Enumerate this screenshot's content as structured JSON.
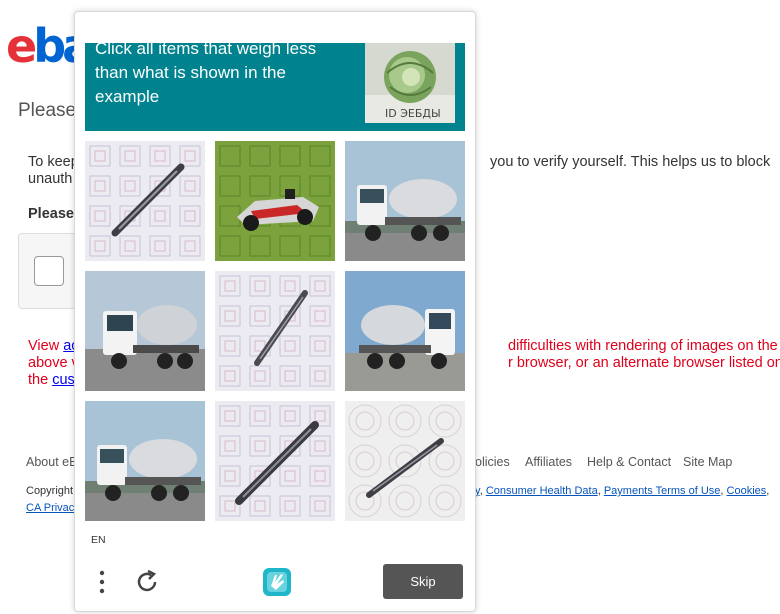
{
  "page": {
    "logo_e": "e",
    "logo_b": "ba",
    "title": "Please",
    "para_left_1": "To keep",
    "para_left_2": "unauth",
    "para_right_1": "you to verify yourself. This helps us to block",
    "please_label": "Please",
    "red_left_1": "View",
    "red_link_1": "ac",
    "red_left_2": "above v",
    "red_left_3": "the",
    "red_link_2": "cus",
    "red_right_1": "difficulties with rendering of images on the",
    "red_right_2": "r browser, or an alternate browser listed on",
    "footer": {
      "about": "About eB",
      "policies": "olicies",
      "affiliates": "Affiliates",
      "help": "Help & Contact",
      "sitemap": "Site Map",
      "copyright": "Copyright",
      "privacy_short": "CA Privac",
      "links_right": [
        ",",
        "Consumer Health Data",
        ",",
        "Payments Terms of Use",
        ",",
        "Cookies",
        ","
      ],
      "link_y": "y"
    }
  },
  "captcha": {
    "prompt": "Click all items that weigh less than what is shown in the example",
    "example_icon": "cabbage-image",
    "tiles": [
      {
        "subject": "pen"
      },
      {
        "subject": "race-car"
      },
      {
        "subject": "cement-truck"
      },
      {
        "subject": "cement-truck"
      },
      {
        "subject": "pen"
      },
      {
        "subject": "cement-truck"
      },
      {
        "subject": "cement-truck"
      },
      {
        "subject": "pen"
      },
      {
        "subject": "pen"
      }
    ],
    "language": "EN",
    "skip_label": "Skip",
    "colors": {
      "prompt_bg": "#00838f",
      "skip_bg": "#555555"
    }
  }
}
